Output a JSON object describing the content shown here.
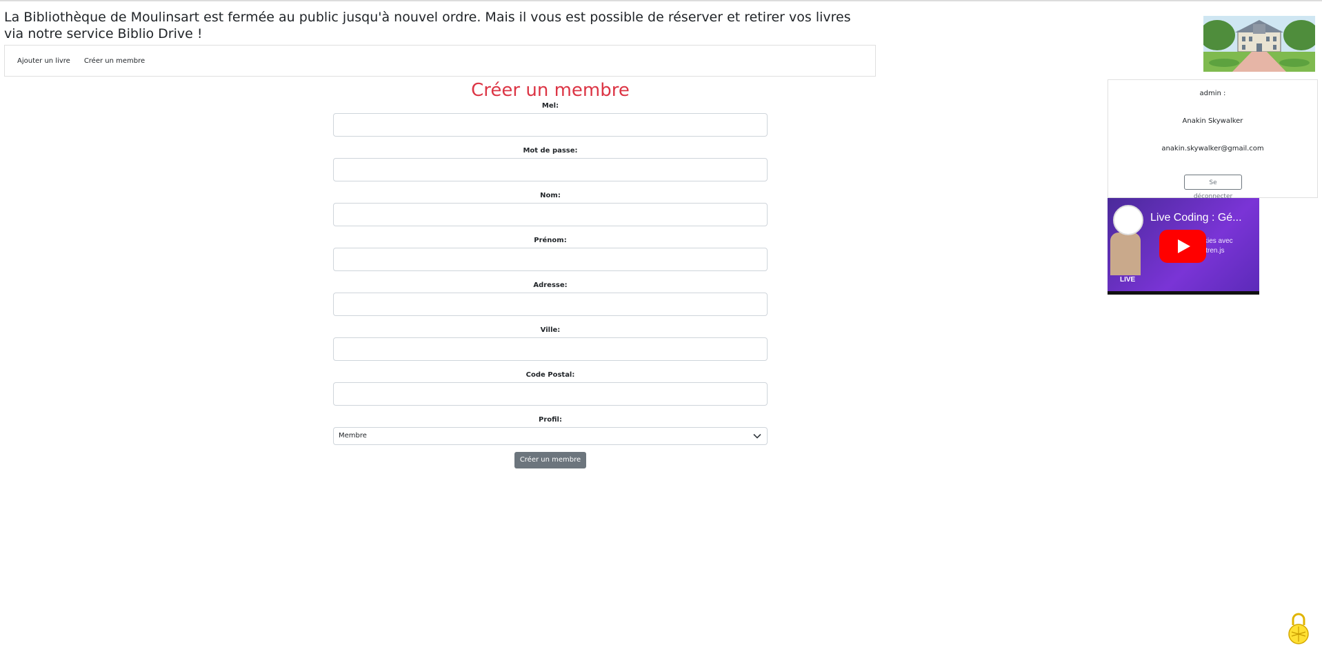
{
  "banner": {
    "text": "La Bibliothèque de Moulinsart est fermée au public jusqu'à nouvel ordre. Mais il vous est possible de réserver et retirer vos livres via notre service Biblio Drive !"
  },
  "nav": {
    "items": [
      {
        "label": "Ajouter un livre"
      },
      {
        "label": "Créer un membre"
      }
    ]
  },
  "form": {
    "title": "Créer un membre",
    "fields": [
      {
        "label": "Mel:",
        "value": ""
      },
      {
        "label": "Mot de passe:",
        "value": ""
      },
      {
        "label": "Nom:",
        "value": ""
      },
      {
        "label": "Prénom:",
        "value": ""
      },
      {
        "label": "Adresse:",
        "value": ""
      },
      {
        "label": "Ville:",
        "value": ""
      },
      {
        "label": "Code Postal:",
        "value": ""
      }
    ],
    "profile": {
      "label": "Profil:",
      "selected": "Membre"
    },
    "submit_label": "Créer un membre"
  },
  "user": {
    "role": "admin :",
    "name": "Anakin Skywalker",
    "email": "anakin.skywalker@gmail.com",
    "logout_label": "Se déconnecter"
  },
  "video": {
    "title": "Live Coding : Gé...",
    "subtitle_1": "kies avec",
    "subtitle_2": "itren.js",
    "badge": "LIVE"
  },
  "colors": {
    "accent_title": "#dc3545",
    "button_grey": "#6c757d",
    "youtube_red": "#ff0000"
  },
  "icons": {
    "chevron": "chevron-down-icon",
    "play": "play-icon",
    "lock": "lock-icon"
  }
}
